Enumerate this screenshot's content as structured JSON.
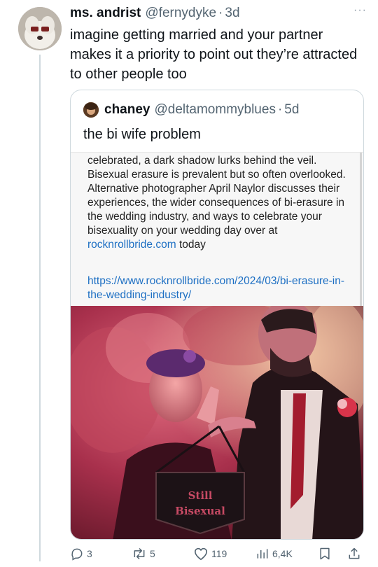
{
  "tweet": {
    "author_name": "ms. andrist",
    "author_handle": "@fernydyke",
    "dot": "·",
    "time": "3d",
    "more_label": "···",
    "text": "imagine getting married and your partner makes it a priority to point out they’re attracted to other people too"
  },
  "quote": {
    "author_name": "chaney",
    "author_handle": "@deltamommyblues",
    "dot": "·",
    "time": "5d",
    "text": "the bi wife problem",
    "screenshot": {
      "body": "celebrated, a dark shadow lurks behind the veil. Bisexual erasure is prevalent but so often overlooked. Alternative photographer April Naylor discusses their experiences,  the wider consequences of bi-erasure in the wedding industry, and ways to celebrate your bisexuality on your wedding day over at ",
      "body_link": "rocknrollbride.com",
      "body_tail": " today",
      "url": "https://www.rocknrollbride.com/2024/03/bi-erasure-in-the-wedding-industry/"
    },
    "photo": {
      "banner_line1": "Still",
      "banner_line2": "Bisexual"
    }
  },
  "actions": {
    "replies": "3",
    "reposts": "5",
    "likes": "119",
    "views": "6,4K"
  },
  "colors": {
    "text": "#0f1419",
    "secondary": "#536471",
    "link": "#1d6fc3",
    "border": "#cfd9de"
  }
}
